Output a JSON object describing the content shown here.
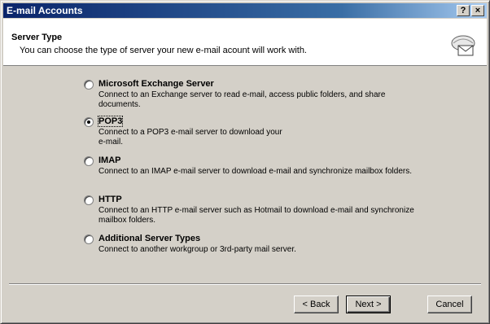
{
  "window": {
    "title": "E-mail Accounts",
    "help_button": "?",
    "close_button": "×"
  },
  "header": {
    "title": "Server Type",
    "subtitle": "You can choose the type of server your new e-mail acount will work with.",
    "icon": "mail-server-icon"
  },
  "options": [
    {
      "label": "Microsoft Exchange Server",
      "description": "Connect to an Exchange server to read e-mail, access public folders, and share documents.",
      "checked": false
    },
    {
      "label": "POP3",
      "description": "Connect to a POP3 e-mail server to download your e-mail.",
      "checked": true
    },
    {
      "label": "IMAP",
      "description": "Connect to an IMAP e-mail server to download e-mail and synchronize mailbox folders.",
      "checked": false
    },
    {
      "label": "HTTP",
      "description": "Connect to an HTTP e-mail server such as Hotmail to download e-mail and synchronize mailbox folders.",
      "checked": false
    },
    {
      "label": "Additional Server Types",
      "description": "Connect to another workgroup or 3rd-party mail server.",
      "checked": false
    }
  ],
  "buttons": {
    "back": "< Back",
    "next": "Next >",
    "cancel": "Cancel"
  }
}
